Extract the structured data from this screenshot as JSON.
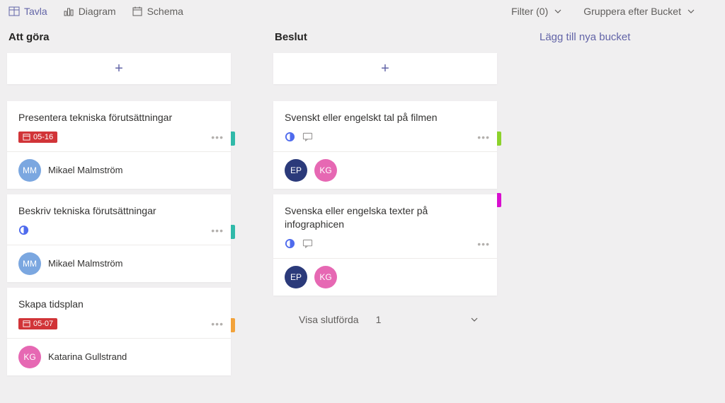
{
  "toolbar": {
    "views": {
      "board": "Tavla",
      "chart": "Diagram",
      "schedule": "Schema"
    },
    "filter_label": "Filter (0)",
    "group_label": "Gruppera efter Bucket"
  },
  "colors": {
    "teal": "#30b9a9",
    "orange": "#f2a23a",
    "lime": "#8cd22c",
    "magenta": "#d80fcf",
    "blue_avatar": "#7ba7e0",
    "navy_avatar": "#2b3a7a",
    "pink_avatar": "#e668b3"
  },
  "buckets": [
    {
      "name": "Att göra",
      "cards": [
        {
          "title": "Presentera tekniska förutsättningar",
          "due": "05-16",
          "progress": null,
          "comments": false,
          "category_color": "teal",
          "category_pos": "mid",
          "assignees": [
            {
              "initials": "MM",
              "name": "Mikael Malmström",
              "color": "blue_avatar"
            }
          ]
        },
        {
          "title": "Beskriv tekniska förutsättningar",
          "due": null,
          "progress": "in_progress",
          "comments": false,
          "category_color": "teal",
          "category_pos": "mid",
          "assignees": [
            {
              "initials": "MM",
              "name": "Mikael Malmström",
              "color": "blue_avatar"
            }
          ]
        },
        {
          "title": "Skapa tidsplan",
          "due": "05-07",
          "progress": null,
          "comments": false,
          "category_color": "orange",
          "category_pos": "mid",
          "assignees": [
            {
              "initials": "KG",
              "name": "Katarina Gullstrand",
              "color": "pink_avatar"
            }
          ]
        }
      ]
    },
    {
      "name": "Beslut",
      "cards": [
        {
          "title": "Svenskt eller engelskt tal på filmen",
          "due": null,
          "progress": "in_progress",
          "comments": true,
          "category_color": "lime",
          "category_pos": "mid",
          "assignees": [
            {
              "initials": "EP",
              "name": null,
              "color": "navy_avatar"
            },
            {
              "initials": "KG",
              "name": null,
              "color": "pink_avatar"
            }
          ]
        },
        {
          "title": "Svenska eller engelska texter på infographicen",
          "due": null,
          "progress": "in_progress",
          "comments": true,
          "category_color": "magenta",
          "category_pos": "top",
          "assignees": [
            {
              "initials": "EP",
              "name": null,
              "color": "navy_avatar"
            },
            {
              "initials": "KG",
              "name": null,
              "color": "pink_avatar"
            }
          ]
        }
      ],
      "completed": {
        "label": "Visa slutförda",
        "count": "1"
      }
    }
  ],
  "add_bucket_label": "Lägg till nya bucket"
}
